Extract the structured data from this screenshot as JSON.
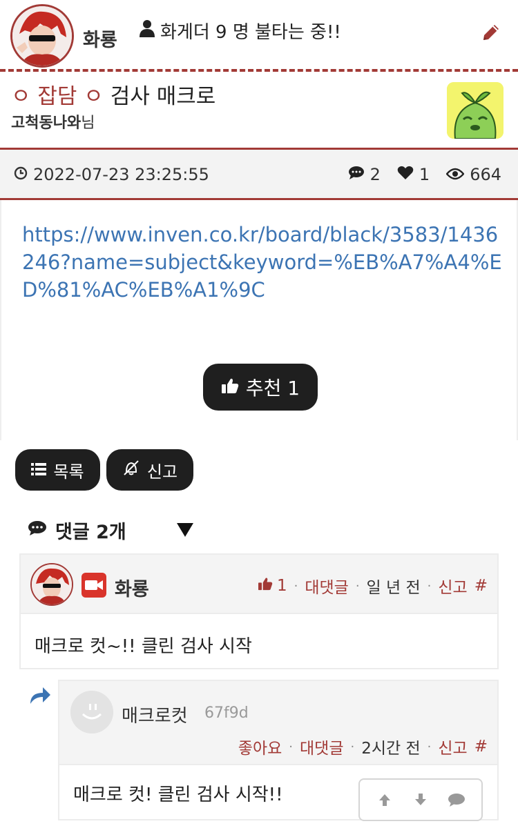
{
  "header": {
    "owner_name": "화룡",
    "online_text": "화게더 9 명 불타는 중!!"
  },
  "post": {
    "category": "ㅇ 잡담 ㅇ",
    "title": "검사 매크로",
    "author_name": "고척동나와",
    "author_suffix": "님",
    "date": "2022-07-23 23:25:55",
    "comment_count": "2",
    "like_count": "1",
    "view_count": "664",
    "link": "https://www.inven.co.kr/board/black/3583/1436246?name=subject&keyword=%EB%A7%A4%ED%81%AC%EB%A1%9C",
    "recommend_label": "추천 1"
  },
  "buttons": {
    "list_label": "목록",
    "report_label": "신고"
  },
  "comments_header": "댓글 2개",
  "comments": [
    {
      "name": "화룡",
      "likes": "1",
      "reply_label": "대댓글",
      "time": "일 년 전",
      "report_label": "신고",
      "hash": "#",
      "text": "매크로 컷~!! 클린 검사 시작"
    },
    {
      "name": "매크로컷",
      "id_hash": "67f9d",
      "like_label": "좋아요",
      "reply_label": "대댓글",
      "time": "2시간 전",
      "report_label": "신고",
      "hash": "#",
      "text": "매크로 컷! 클린 검사 시작!!"
    }
  ],
  "colors": {
    "accent": "#a23a36",
    "link": "#3c74b3",
    "dark_button": "#1f1f1f",
    "panel_bg": "#f4f4f4"
  },
  "icons": [
    "user-icon",
    "pencil-icon",
    "clock-icon",
    "comment-icon",
    "heart-icon",
    "eye-icon",
    "thumbs-up-icon",
    "list-icon",
    "bell-slash-icon",
    "triangle-down-icon",
    "camera-badge-icon",
    "reply-arrow-icon",
    "arrow-up-icon",
    "arrow-down-icon"
  ]
}
